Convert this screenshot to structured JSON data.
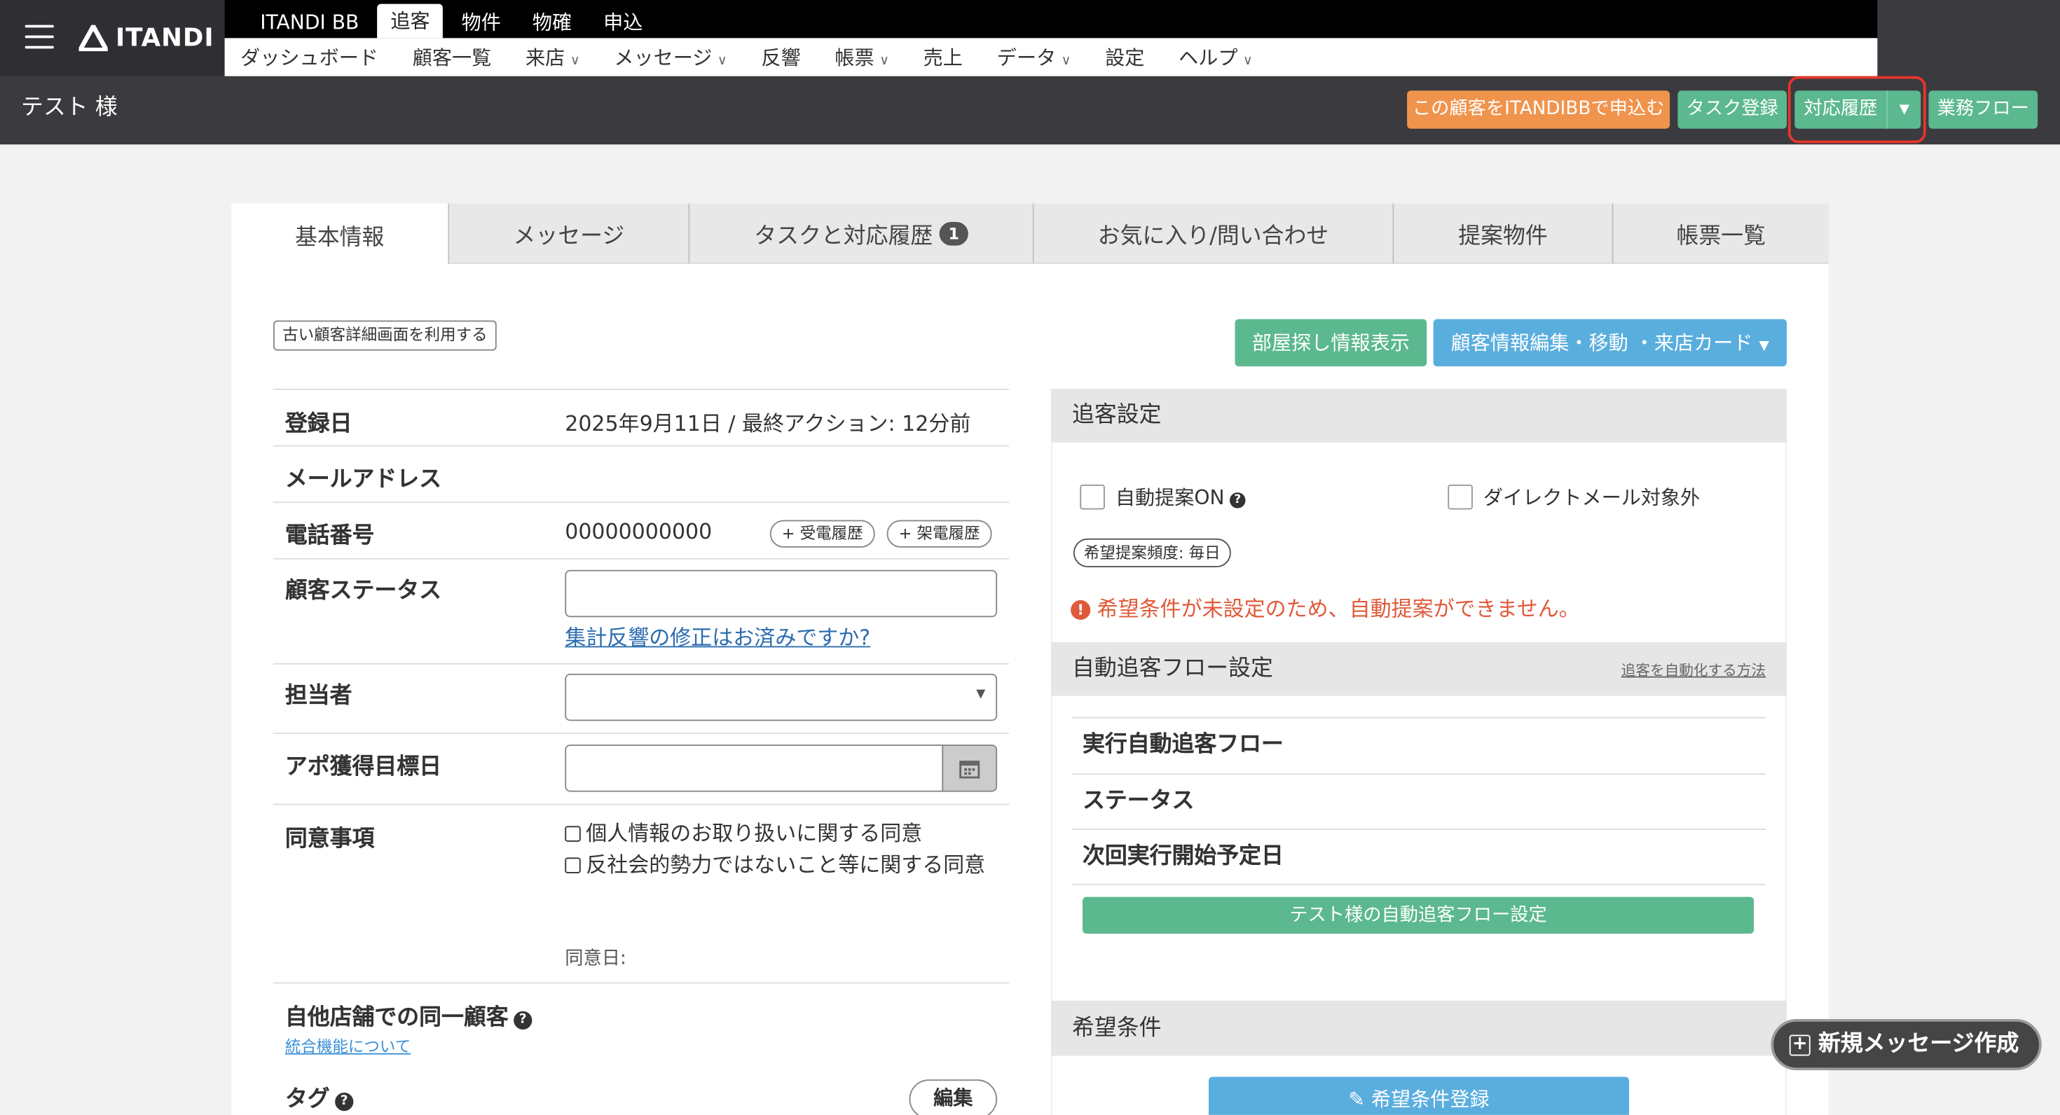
{
  "header": {
    "logo": "ITANDI",
    "nav_top": [
      {
        "label": "ITANDI BB"
      },
      {
        "label": "追客"
      },
      {
        "label": "物件"
      },
      {
        "label": "物確"
      },
      {
        "label": "申込"
      }
    ],
    "nav_sub": [
      {
        "label": "ダッシュボード"
      },
      {
        "label": "顧客一覧"
      },
      {
        "label": "来店"
      },
      {
        "label": "メッセージ"
      },
      {
        "label": "反響"
      },
      {
        "label": "帳票"
      },
      {
        "label": "売上"
      },
      {
        "label": "データ"
      },
      {
        "label": "設定"
      },
      {
        "label": "ヘルプ"
      }
    ],
    "customer_name": "テスト 様",
    "btn_apply": "この顧客をITANDIBBで申込む",
    "btn_task": "タスク登録",
    "btn_history": "対応履歴",
    "btn_flow": "業務フロー"
  },
  "tabs": [
    {
      "label": "基本情報"
    },
    {
      "label": "メッセージ"
    },
    {
      "label": "タスクと対応履歴",
      "badge": "1"
    },
    {
      "label": "お気に入り/問い合わせ"
    },
    {
      "label": "提案物件"
    },
    {
      "label": "帳票一覧"
    }
  ],
  "basic": {
    "old_button": "古い顧客詳細画面を利用する",
    "btn_room": "部屋探し情報表示",
    "btn_edit": "顧客情報編集・移動 ・来店カード",
    "registered_label": "登録日",
    "registered_value": "2025年9月11日 / 最終アクション: 12分前",
    "email_label": "メールアドレス",
    "phone_label": "電話番号",
    "phone_value": "00000000000",
    "btn_incoming": "+ 受電履歴",
    "btn_outgoing": "+ 架電履歴",
    "status_label": "顧客ステータス",
    "status_link": "集計反響の修正はお済みですか?",
    "staff_label": "担当者",
    "appo_label": "アポ獲得目標日",
    "consent_label": "同意事項",
    "consent_1": "個人情報のお取り扱いに関する同意",
    "consent_2": "反社会的勢力ではないこと等に関する同意",
    "consent_date": "同意日:",
    "same_customer_label": "自他店舗での同一顧客",
    "merge_link": "統合機能について",
    "tag_label": "タグ",
    "btn_tag_edit": "編集"
  },
  "tracking": {
    "title": "追客設定",
    "auto_suggest": "自動提案ON",
    "direct_mail": "ダイレクトメール対象外",
    "frequency": "希望提案頻度: 毎日",
    "warning": "希望条件が未設定のため、自動提案ができません。",
    "warning_color": "#e05a3a"
  },
  "autoflow": {
    "title": "自動追客フロー設定",
    "howto_link": "追客を自動化する方法",
    "row1": "実行自動追客フロー",
    "row2": "ステータス",
    "row3": "次回実行開始予定日",
    "button": "テスト様の自動追客フロー設定"
  },
  "conditions": {
    "title": "希望条件",
    "button": "✎ 希望条件登録"
  },
  "new_message": "新規メッセージ作成"
}
